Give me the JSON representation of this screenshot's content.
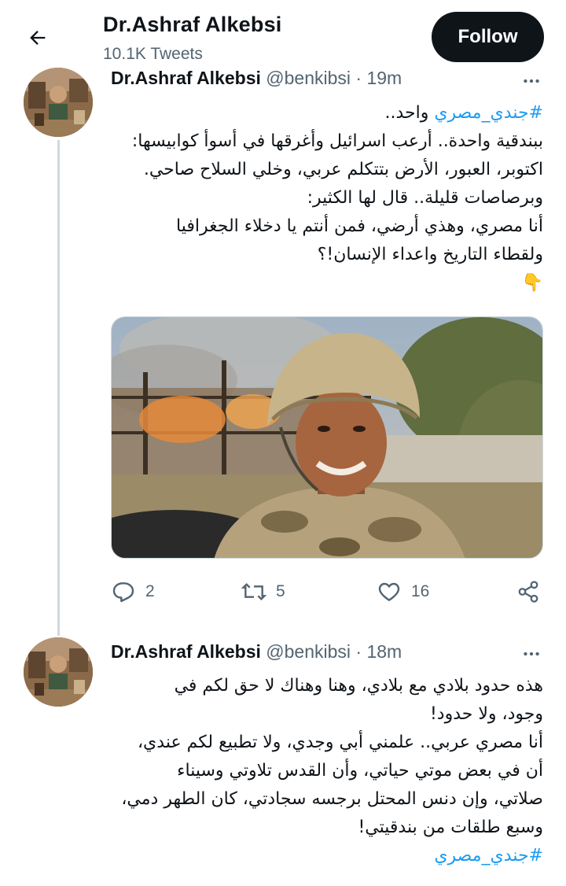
{
  "header": {
    "name": "Dr.Ashraf Alkebsi",
    "tweet_count": "10.1K Tweets",
    "follow_label": "Follow"
  },
  "tweets": [
    {
      "name": "Dr.Ashraf Alkebsi",
      "handle": "@benkibsi",
      "separator": "·",
      "time": "19m",
      "hashtag": "#جندي_مصري",
      "lines": [
        "واحد..",
        "ببندقية واحدة.. أرعب اسرائيل وأغرقها في أسوأ كوابيسها:",
        "اكتوبر، العبور، الأرض بتتكلم عربي، وخلي السلاح صاحي.",
        "وبرصاصات قليلة.. قال لها الكثير:",
        "أنا مصري، وهذي أرضي، فمن أنتم يا دخلاء الجغرافيا",
        "ولقطاء التاريخ واعداء الإنسان!؟"
      ],
      "emoji": "👇",
      "replies": "2",
      "retweets": "5",
      "likes": "16"
    },
    {
      "name": "Dr.Ashraf Alkebsi",
      "handle": "@benkibsi",
      "separator": "·",
      "time": "18m",
      "lines": [
        "هذه حدود بلادي مع بلادي، وهنا وهناك لا حق لكم في",
        "وجود، ولا حدود!",
        "أنا مصري عربي.. علمني أبي وجدي، ولا تطبيع لكم عندي،",
        "أن في بعض موتي حياتي، وأن القدس تلاوتي وسيناء",
        "صلاتي، وإن دنس المحتل برجسه سجادتي، كان الطهر دمي،",
        "وسبع طلقات من بندقيتي!"
      ],
      "hashtag": "#جندي_مصري"
    }
  ],
  "icons": {
    "back": "back-arrow-icon",
    "more": "more-icon",
    "reply": "reply-icon",
    "retweet": "retweet-icon",
    "like": "like-icon",
    "share": "share-icon"
  },
  "colors": {
    "accent": "#1d9bf0",
    "text": "#0f1419",
    "muted": "#536471",
    "button": "#0f1419"
  }
}
